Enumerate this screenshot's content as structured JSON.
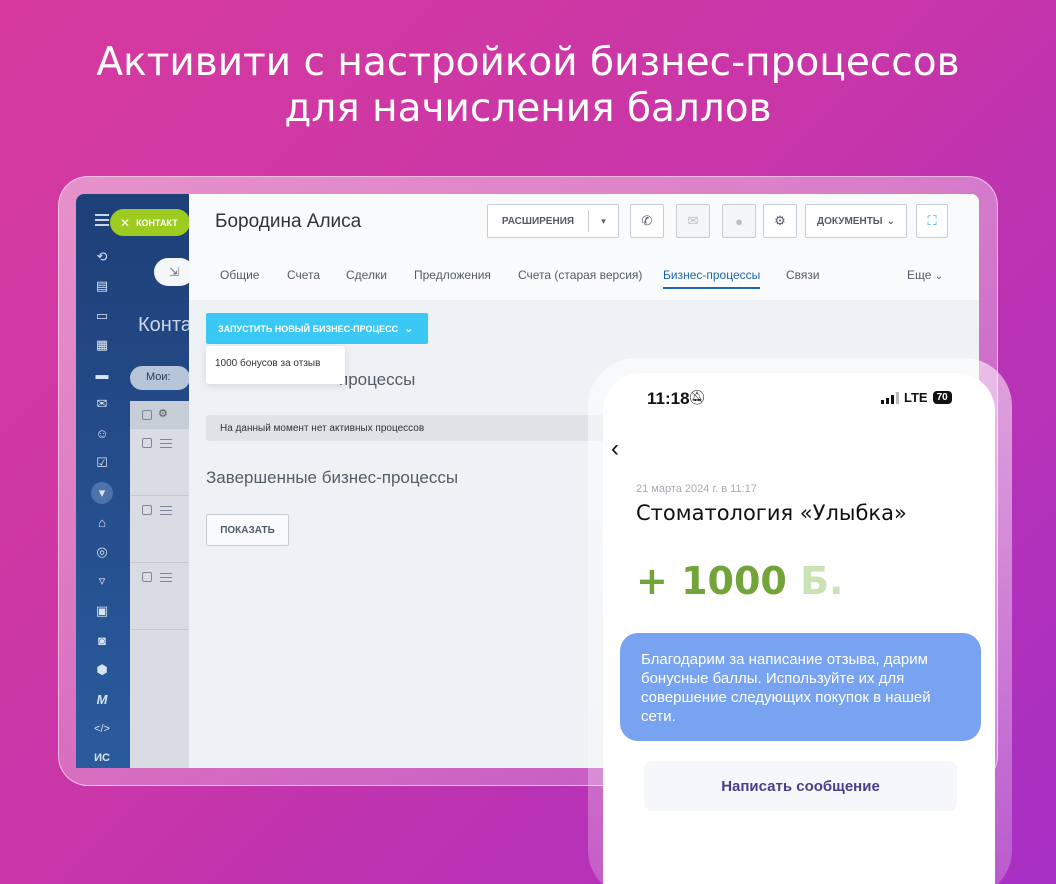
{
  "headline": {
    "line1": "Активити с настройкой бизнес-процессов",
    "line2": "для начисления баллов"
  },
  "crm": {
    "sidebar": {
      "contact_pill": "КОНТАКТ",
      "bg_title": "Конта",
      "moi_label": "Мои:",
      "icons": [
        "arrows-icon",
        "document-icon",
        "chat-icon",
        "calendar-icon",
        "inbox-icon",
        "mail-icon",
        "people-icon",
        "check-icon",
        "filter-icon",
        "bank-icon",
        "target-icon",
        "cart-icon",
        "id-card-icon",
        "robot-icon",
        "database-icon",
        "m-logo-icon",
        "code-icon"
      ],
      "is_label": "ИС"
    },
    "contact_name": "Бородина Алиса",
    "toolbar": {
      "extensions_label": "РАСШИРЕНИЯ",
      "documents_label": "ДОКУМЕНТЫ"
    },
    "tabs": [
      {
        "label": "Общие",
        "active": false
      },
      {
        "label": "Счета",
        "active": false
      },
      {
        "label": "Сделки",
        "active": false
      },
      {
        "label": "Предложения",
        "active": false
      },
      {
        "label": "Счета (старая версия)",
        "active": false
      },
      {
        "label": "Бизнес-процессы",
        "active": true
      },
      {
        "label": "Связи",
        "active": false
      }
    ],
    "more_label": "Еще",
    "start_button": "ЗАПУСТИТЬ НОВЫЙ БИЗНЕС-ПРОЦЕСС",
    "dropdown_item": "1000 бонусов за отзыв",
    "active_section_tail": "процессы",
    "no_active": "На данный момент нет активных процессов",
    "done_section": "Завершенные бизнес-процессы",
    "show_button": "ПОКАЗАТЬ",
    "colors": {
      "accent": "#3bc8f5",
      "sidebar": "#244c8a",
      "active_tab": "#2066b0",
      "pill": "#9ecb20"
    }
  },
  "phone": {
    "time": "11:18",
    "network": "LTE",
    "battery": "70",
    "notification": {
      "date": "21 марта 2024 г. в 11:17",
      "shop": "Стоматология «Улыбка»",
      "points_value": "+ 1000",
      "points_unit": "Б.",
      "message": "Благодарим за написание отзыва, дарим бонусные баллы. Используйте их для совершение следующих покупок в нашей сети.",
      "write_button": "Написать сообщение"
    },
    "colors": {
      "points": "#72a43a",
      "bubble": "#78a3f0",
      "button_text": "#4a3f8c"
    }
  }
}
